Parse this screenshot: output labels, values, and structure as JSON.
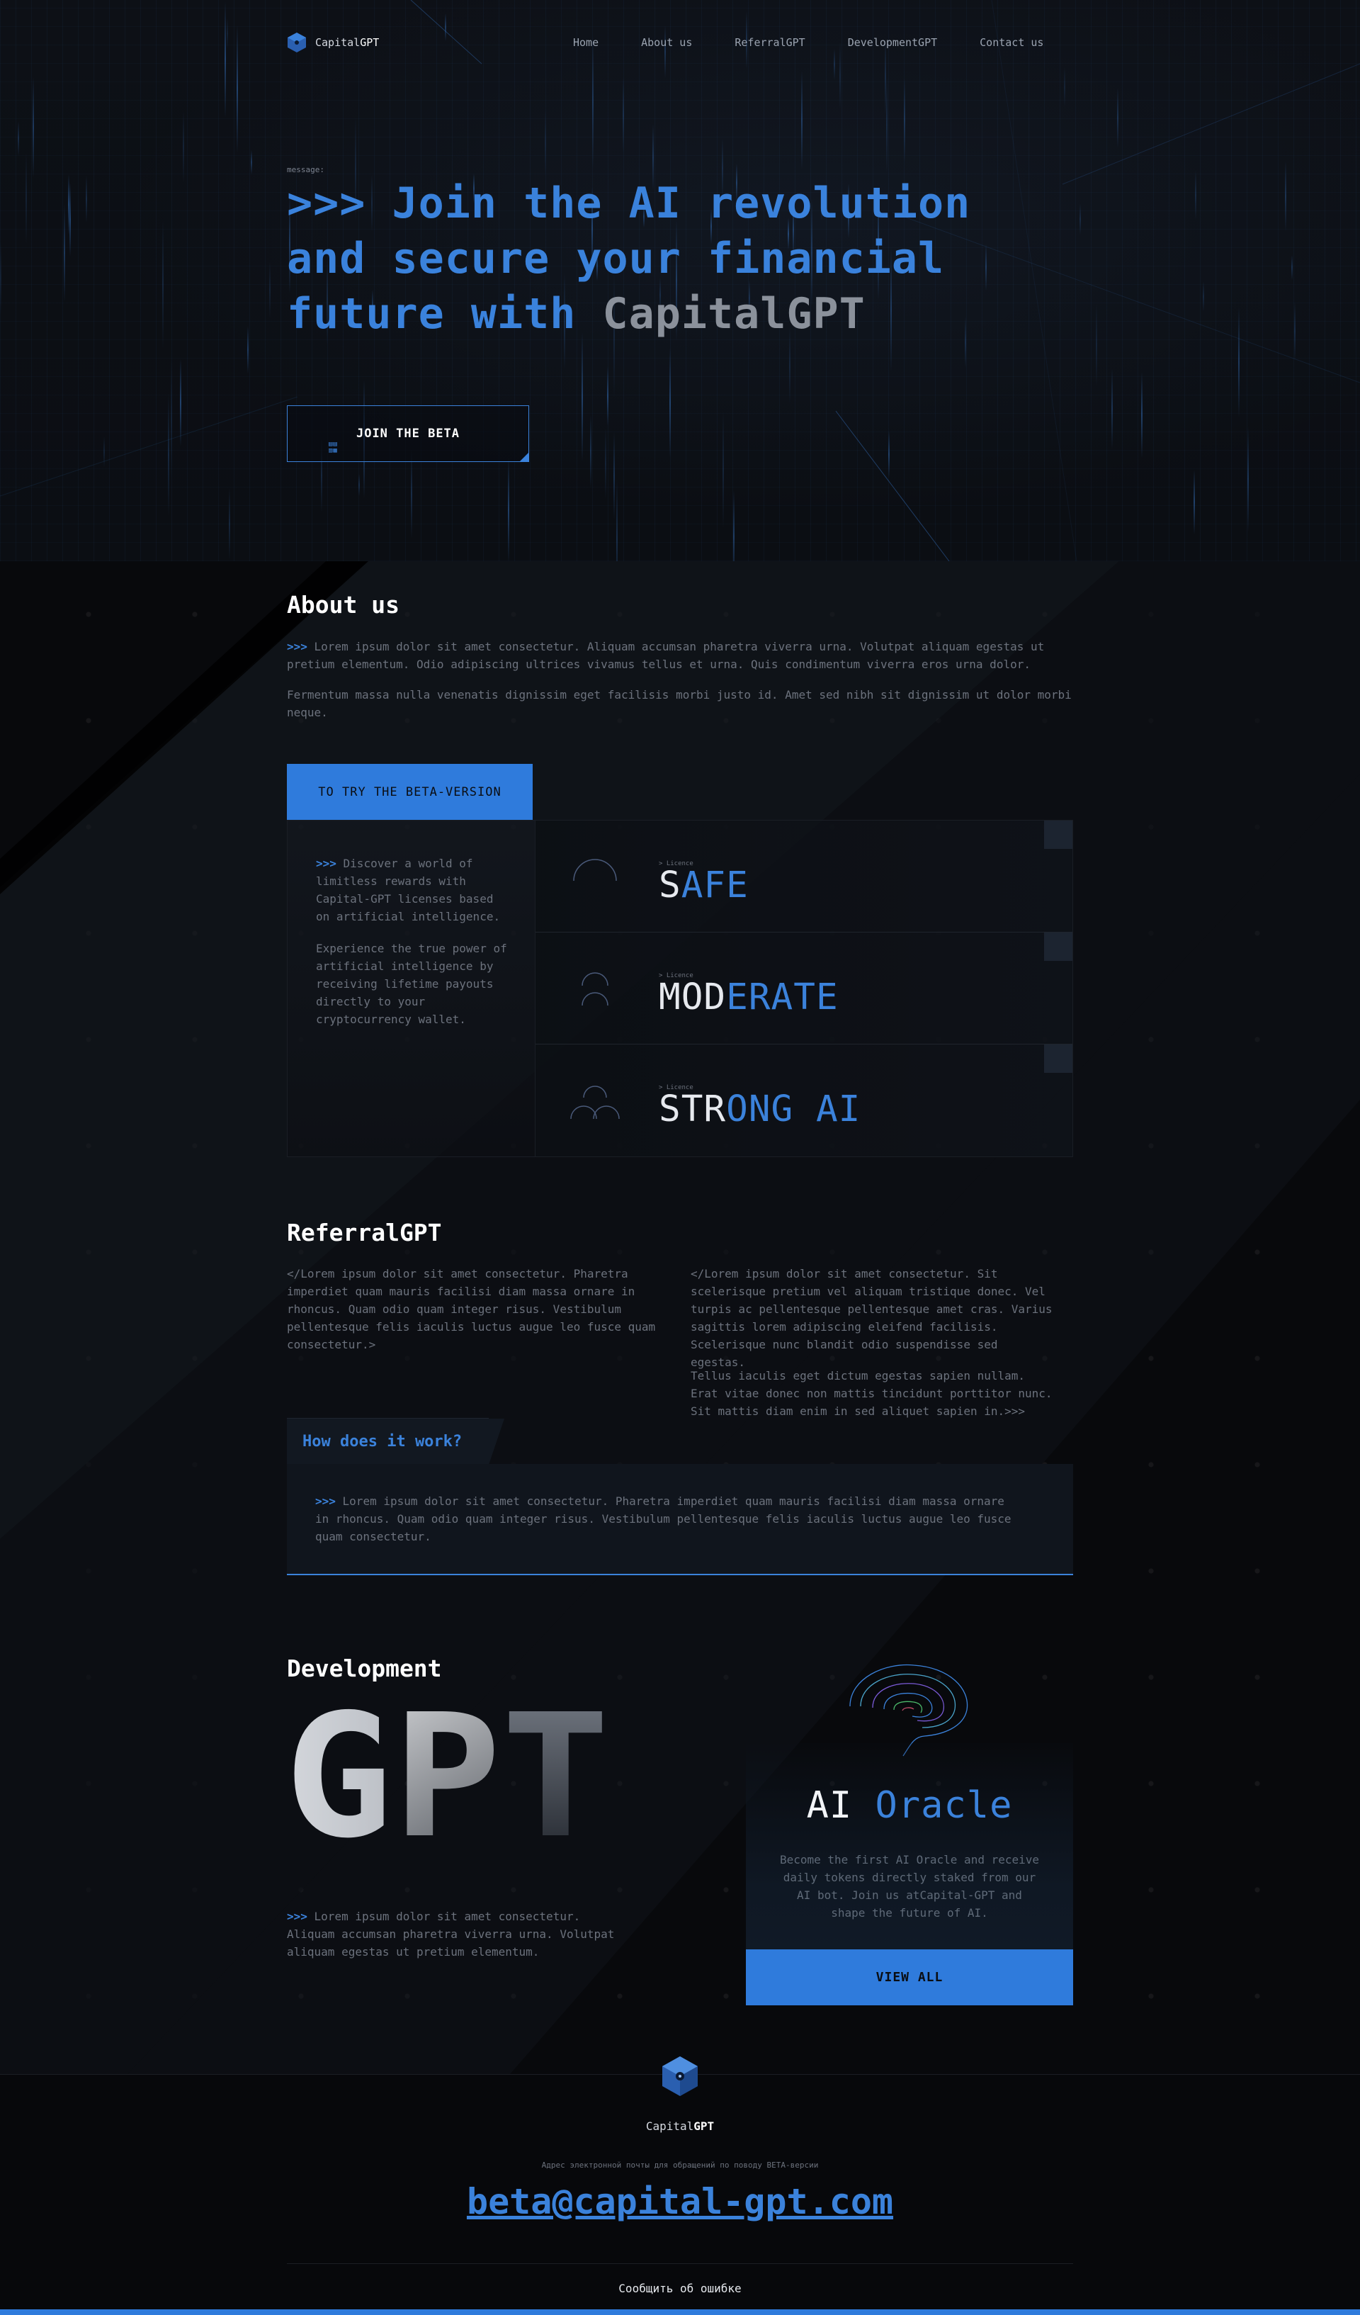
{
  "brand": {
    "prefix": "Capital",
    "suffix": "GPT"
  },
  "nav": [
    "Home",
    "About us",
    "ReferralGPT",
    "DevelopmentGPT",
    "Contact us"
  ],
  "hero": {
    "message_label": "message:",
    "title_line1": ">>> Join the AI revolution",
    "title_line2": "and secure your financial",
    "title_line3_blue": "future with ",
    "title_line3_grey": "CapitalGPT",
    "cta": "JOIN THE BETA"
  },
  "about": {
    "title": "About us",
    "prompt": ">>>",
    "p1": " Lorem ipsum dolor sit amet consectetur. Aliquam accumsan pharetra viverra urna. Volutpat aliquam egestas ut pretium elementum. Odio adipiscing ultrices vivamus tellus et urna. Quis condimentum viverra eros urna dolor.",
    "p2": "Fermentum massa nulla venenatis dignissim eget facilisis morbi justo id. Amet sed nibh sit dignissim ut dolor morbi neque.",
    "try_button": "TO TRY THE BETA-VERSION",
    "left_prompt": ">>>",
    "left_p1": " Discover a world of limitless rewards with Capital-GPT licenses based on artificial intelligence.",
    "left_p2": "Experience the true power of artificial intelligence by receiving lifetime payouts directly to your cryptocurrency wallet.",
    "licences": [
      {
        "small": "> Licence",
        "white": "S",
        "blue": "AFE"
      },
      {
        "small": "> Licence",
        "white": "MOD",
        "blue": "ERATE"
      },
      {
        "small": "> Licence",
        "white": "STR",
        "blue": "ONG AI"
      }
    ]
  },
  "referral": {
    "title": "ReferralGPT",
    "col1": "</Lorem ipsum dolor sit amet consectetur. Pharetra imperdiet quam mauris facilisi diam massa ornare in rhoncus. Quam odio quam integer risus. Vestibulum pellentesque felis iaculis luctus augue leo fusce quam consectetur.>",
    "col2_p1": "</Lorem ipsum dolor sit amet consectetur. Sit scelerisque pretium vel aliquam tristique donec. Vel turpis ac pellentesque pellentesque amet cras. Varius sagittis lorem adipiscing eleifend facilisis. Scelerisque nunc blandit odio suspendisse sed egestas.",
    "col2_p2": "Tellus iaculis eget dictum egestas sapien nullam. Erat vitae donec non mattis tincidunt porttitor nunc. Sit mattis diam enim in sed aliquet sapien in.>>>",
    "how_title": "How does it work?",
    "how_prompt": ">>>",
    "how_text": " Lorem ipsum dolor sit amet consectetur. Pharetra imperdiet quam mauris facilisi diam massa ornare in rhoncus. Quam odio quam integer risus. Vestibulum pellentesque felis iaculis luctus augue leo fusce quam consectetur."
  },
  "development": {
    "title": "Development",
    "big_word": "GPT",
    "prompt": ">>>",
    "text": " Lorem ipsum dolor sit amet consectetur. Aliquam accumsan pharetra viverra urna. Volutpat aliquam egestas ut pretium elementum.",
    "oracle_white": "AI ",
    "oracle_blue": "Oracle",
    "oracle_text": "Become the first AI Oracle and receive daily tokens directly staked from our AI bot. Join us atCapital-GPT and shape the future of AI.",
    "view_all": "VIEW ALL"
  },
  "footer": {
    "brand_prefix": "Capital",
    "brand_suffix": "GPT",
    "small": "Адрес электронной почты для обращений по поводу BETA-версии",
    "email": "beta@capital-gpt.com",
    "report": "Сообщить об ошибке"
  },
  "colors": {
    "accent": "#3b82db",
    "button": "#2f7bdc",
    "background": "#08090c"
  }
}
